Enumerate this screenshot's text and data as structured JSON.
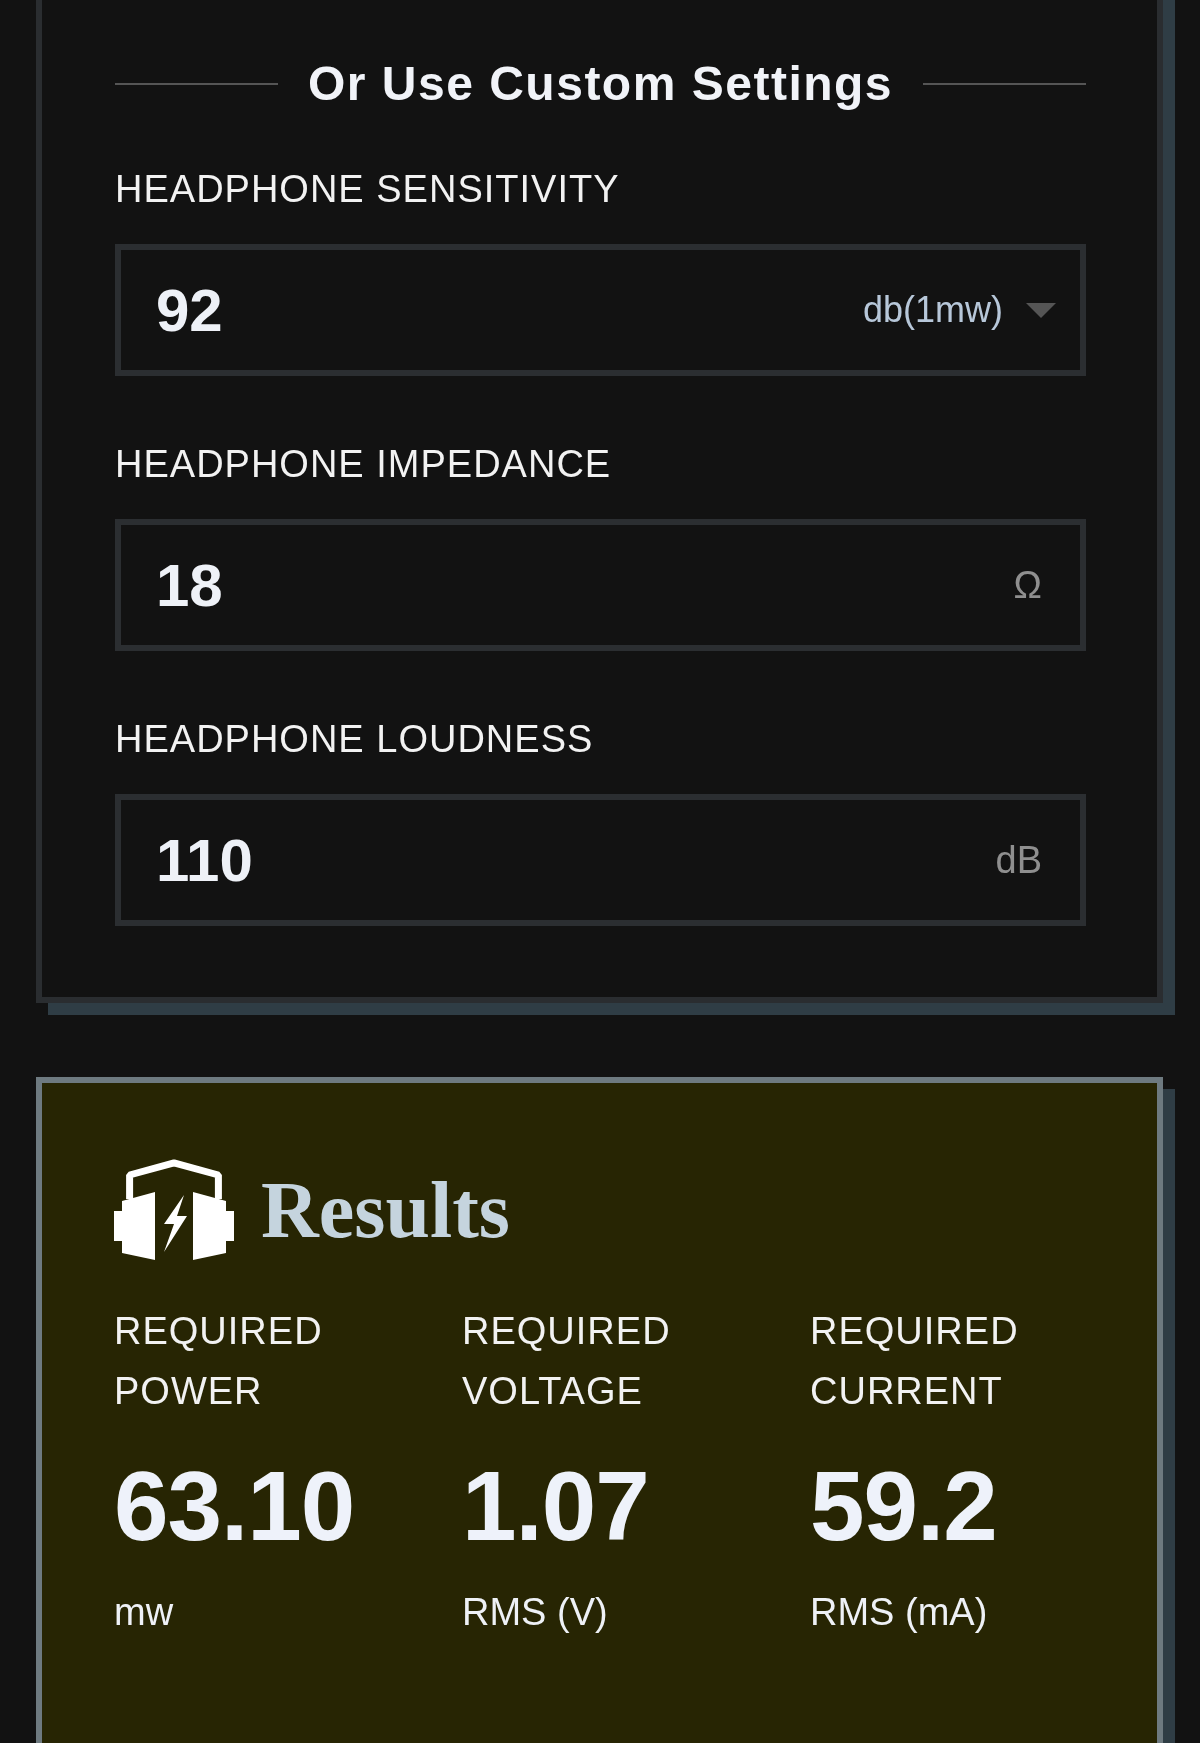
{
  "custom_settings": {
    "title": "Or Use Custom Settings",
    "fields": [
      {
        "kind": "select",
        "label": "HEADPHONE SENSITIVITY",
        "value": "92",
        "unit": "db(1mw)"
      },
      {
        "kind": "input",
        "label": "HEADPHONE IMPEDANCE",
        "value": "18",
        "unit": "Ω"
      },
      {
        "kind": "input",
        "label": "HEADPHONE LOUDNESS",
        "value": "110",
        "unit": "dB"
      }
    ]
  },
  "results": {
    "title": "Results",
    "items": [
      {
        "label": "REQUIRED POWER",
        "value": "63.10",
        "unit": "mw"
      },
      {
        "label": "REQUIRED VOLTAGE",
        "value": "1.07",
        "unit": "RMS (V)"
      },
      {
        "label": "REQUIRED CURRENT",
        "value": "59.2",
        "unit": "RMS (mA)"
      }
    ]
  }
}
